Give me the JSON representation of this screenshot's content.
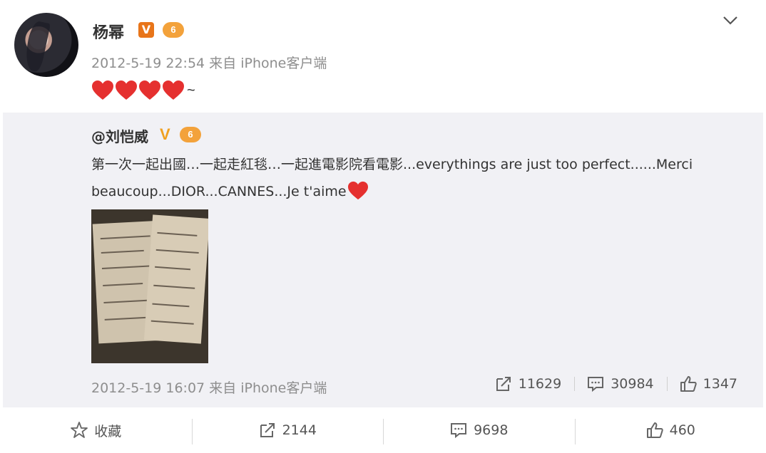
{
  "post": {
    "username": "杨幂",
    "verified_badge": "V",
    "level_badge": "6",
    "timestamp": "2012-5-19 22:54",
    "source": "来自 iPhone客户端",
    "content_tail": "~",
    "menu_icon": "chevron-down-icon"
  },
  "repost": {
    "username": "@刘恺威",
    "verified_badge": "V",
    "level_badge": "6",
    "text": "第一次一起出國…一起走紅毯…一起進電影院看電影...everythings are just too perfect......Merci beaucoup...DIOR...CANNES...Je t'aime",
    "timestamp": "2012-5-19 16:07",
    "source": "来自 iPhone客户端",
    "stats": {
      "reposts": "11629",
      "comments": "30984",
      "likes": "1347"
    }
  },
  "actions": {
    "favorite_label": "收藏",
    "reposts": "2144",
    "comments": "9698",
    "likes": "460"
  },
  "colors": {
    "heart": "#e5302f",
    "meta": "#8e8e8e",
    "repost_bg": "#f1f1f5",
    "badge_orange": "#e8751a"
  }
}
